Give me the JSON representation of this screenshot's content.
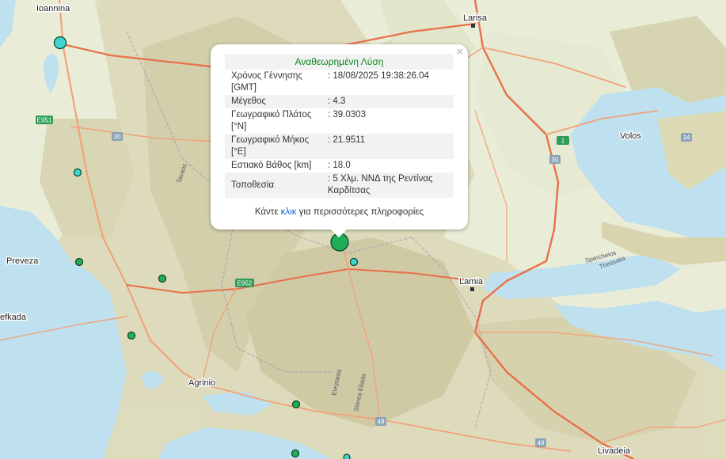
{
  "map": {
    "places": [
      {
        "name": "Ioannina"
      },
      {
        "name": "Larisa"
      },
      {
        "name": "Volos"
      },
      {
        "name": "Preveza"
      },
      {
        "name": "Lamia"
      },
      {
        "name": "Agrinio"
      },
      {
        "name": "Lefkada",
        "shown": "efkada"
      },
      {
        "name": "Livadeia"
      }
    ],
    "road_shields": [
      "E951",
      "30",
      "1",
      "30",
      "34",
      "E952",
      "48",
      "48"
    ],
    "road_labels": [
      "Tavaos",
      "Spercheios",
      "Evrytania",
      "Sterea Ellada",
      "Thessalia"
    ],
    "water_color": "#bfe0ee",
    "marker_colors": {
      "cyan": "#3fd6cf",
      "green": "#1fae55"
    }
  },
  "popup": {
    "title": "Αναθεωρημένη Λύση",
    "close": "×",
    "rows": [
      {
        "label": "Χρόνος Γέννησης [GMT]",
        "value": ": 18/08/2025 19:38:26.04"
      },
      {
        "label": "Μέγεθος",
        "value": ": 4.3"
      },
      {
        "label": "Γεωγραφικό Πλάτος [°N]",
        "value": ": 39.0303"
      },
      {
        "label": "Γεωγραφικό Μήκος [°E]",
        "value": ": 21.9511"
      },
      {
        "label": "Εστιακό Βάθος [km]",
        "value": ": 18.0"
      },
      {
        "label": "Τοποθεσία",
        "value": ": 5 Χλμ. ΝΝΔ της Ρεντίνας Καρδίτσας"
      }
    ],
    "more_prefix": "Κάντε ",
    "more_link": "κλικ",
    "more_suffix": " για περισσότερες πληροφορίες"
  }
}
